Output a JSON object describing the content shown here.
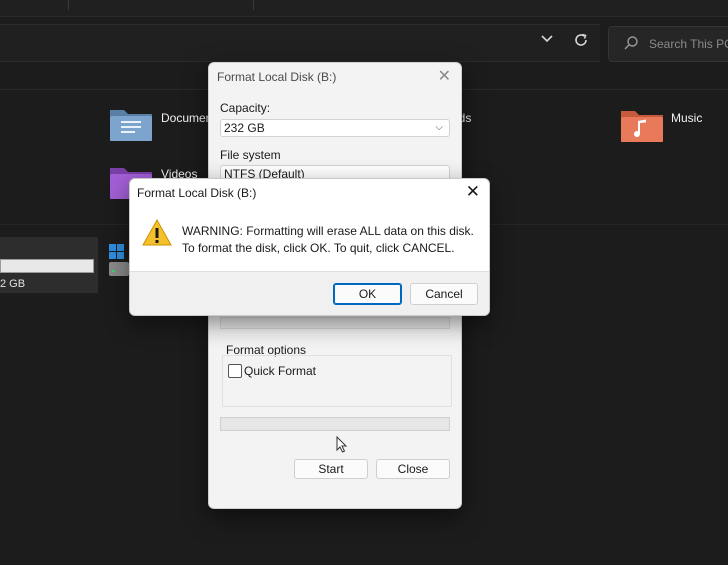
{
  "explorer": {
    "search_placeholder": "Search This PC",
    "folders": [
      {
        "label": "Documen",
        "icon": "documents-folder-icon"
      },
      {
        "label": "ads",
        "icon": "downloads-folder-icon"
      },
      {
        "label": "Music",
        "icon": "music-folder-icon"
      },
      {
        "label": "Videos",
        "icon": "videos-folder-icon"
      }
    ],
    "drive_size_text": "2 GB"
  },
  "format_dialog": {
    "title": "Format Local Disk (B:)",
    "capacity_label": "Capacity:",
    "capacity_value": "232 GB",
    "filesystem_label": "File system",
    "filesystem_value": "NTFS (Default)",
    "format_options_label": "Format options",
    "quick_format_label": "Quick Format",
    "quick_format_checked": false,
    "start_label": "Start",
    "close_label": "Close"
  },
  "warning_dialog": {
    "title": "Format Local Disk (B:)",
    "message_line1": "WARNING: Formatting will erase ALL data on this disk.",
    "message_line2": "To format the disk, click OK. To quit, click CANCEL.",
    "ok_label": "OK",
    "cancel_label": "Cancel",
    "accent_color": "#0067c0"
  }
}
